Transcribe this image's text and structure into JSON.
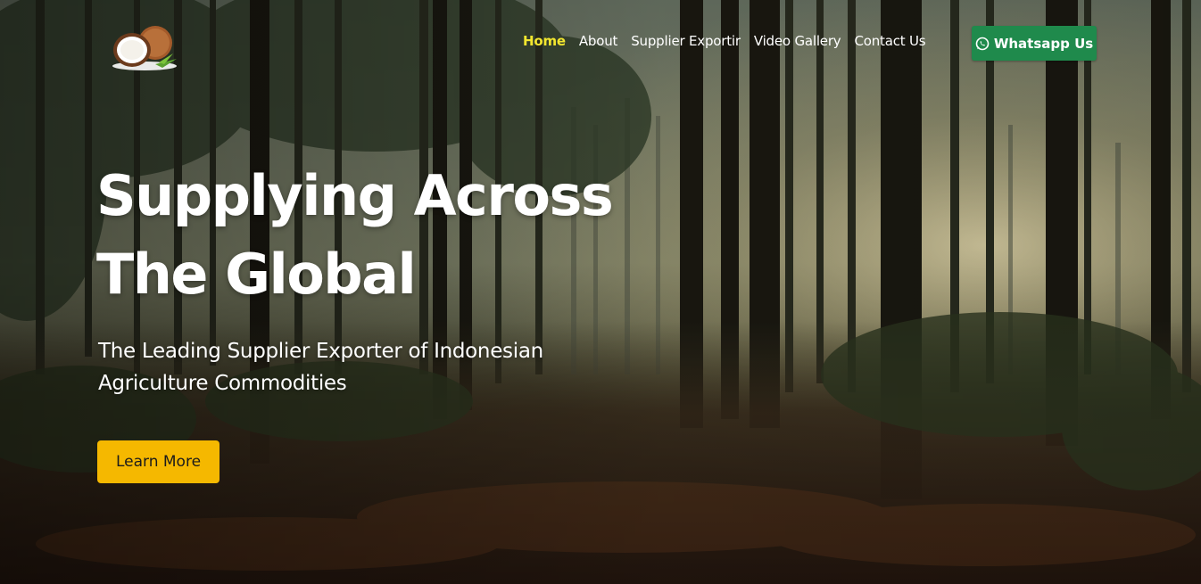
{
  "nav": {
    "items": [
      {
        "label": "Home",
        "active": true
      },
      {
        "label": "About"
      },
      {
        "label": "Supplier Exportir"
      },
      {
        "label": "Video Gallery"
      },
      {
        "label": "Contact Us"
      }
    ]
  },
  "whatsapp": {
    "label": "Whatsapp Us",
    "color": "#1f8a4c",
    "icon": "whatsapp-icon"
  },
  "hero": {
    "title_line1": "Supplying Across",
    "title_line2": "The Global",
    "subtitle_line1": "The Leading Supplier Exporter of Indonesian",
    "subtitle_line2": "Agriculture Commodities",
    "cta_label": "Learn More",
    "cta_color": "#f5b800",
    "active_nav_color": "#f2e62f"
  },
  "logo": {
    "icon": "coconut-logo-icon"
  }
}
